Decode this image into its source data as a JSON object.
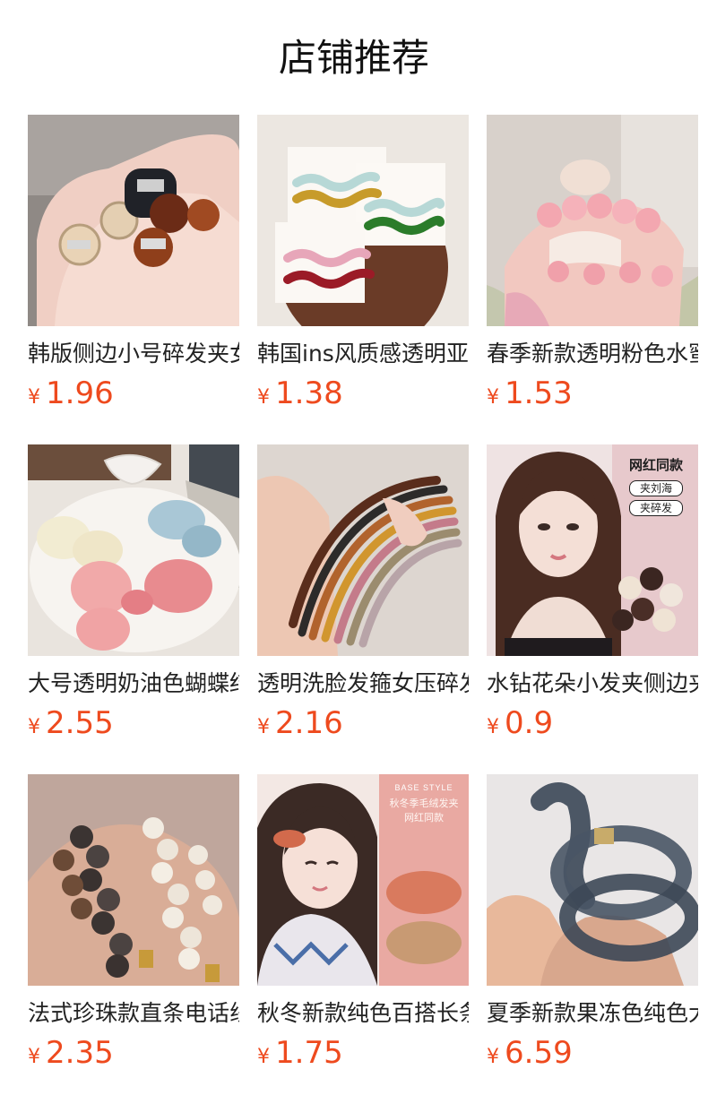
{
  "page": {
    "title": "店铺推荐"
  },
  "colors": {
    "price": "#ee4a1e",
    "title": "#111111"
  },
  "products": [
    {
      "name": "韩版侧边小号碎发夹女",
      "currency": "¥",
      "price": "1.96",
      "image": "hand-holding-rhinestone-claw-clips"
    },
    {
      "name": "韩国ins风质感透明亚克力",
      "currency": "¥",
      "price": "1.38",
      "image": "wavy-acrylic-hair-clips-on-cards"
    },
    {
      "name": "春季新款透明粉色水蜜桃",
      "currency": "¥",
      "price": "1.53",
      "image": "pink-peach-claw-clip"
    },
    {
      "name": "大号透明奶油色蝴蝶结抓夹",
      "currency": "¥",
      "price": "2.55",
      "image": "cream-bow-claw-clips-on-plate"
    },
    {
      "name": "透明洗脸发箍女压碎发",
      "currency": "¥",
      "price": "2.16",
      "image": "transparent-headbands-in-hand"
    },
    {
      "name": "水钻花朵小发夹侧边夹",
      "currency": "¥",
      "price": "0.9",
      "image": "girl-with-flower-clips",
      "badge_lines": [
        "网红同款",
        "夹刘海",
        "夹碎发"
      ]
    },
    {
      "name": "法式珍珠款直条电话线",
      "currency": "¥",
      "price": "2.35",
      "image": "pearl-bead-hair-clips"
    },
    {
      "name": "秋冬新款纯色百搭长条",
      "currency": "¥",
      "price": "1.75",
      "image": "girl-with-plush-hair-clips",
      "banner_lines": [
        "BASE STYLE",
        "秋冬季毛绒发夹",
        "网红同款"
      ]
    },
    {
      "name": "夏季新款果冻色纯色大号",
      "currency": "¥",
      "price": "6.59",
      "image": "grey-jelly-claw-clip"
    }
  ]
}
